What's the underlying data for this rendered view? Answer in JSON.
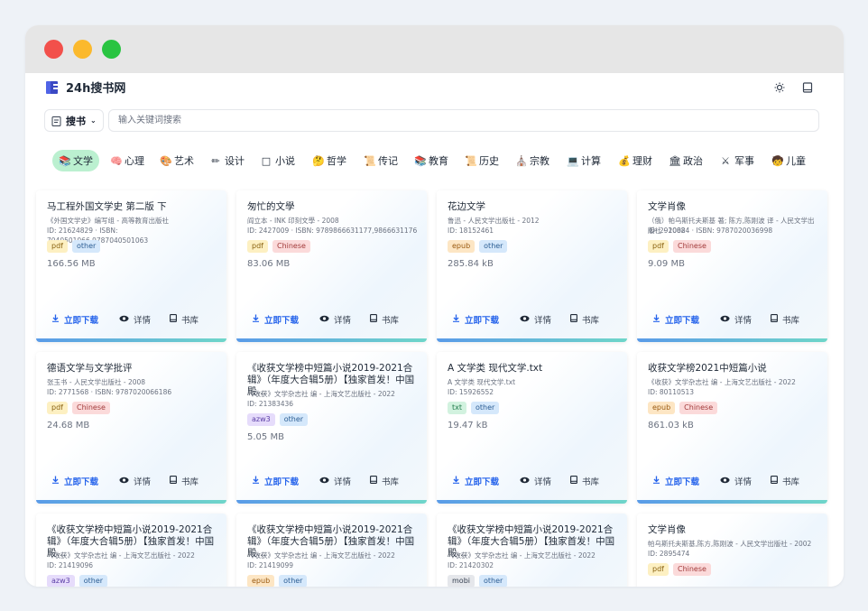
{
  "app": {
    "title": "24h搜书网",
    "search_type_label": "搜书",
    "search_placeholder": "输入关键词搜索",
    "search_value": "",
    "icons": {
      "logo": "book-logo-icon",
      "theme": "sun-icon",
      "library": "book-icon",
      "search_type": "clipboard-icon",
      "dropdown": "chevron-down-icon"
    }
  },
  "categories": [
    {
      "label": "文学",
      "icon": "📚",
      "active": true
    },
    {
      "label": "心理",
      "icon": "🧠"
    },
    {
      "label": "艺术",
      "icon": "🎨"
    },
    {
      "label": "设计",
      "icon": "✏"
    },
    {
      "label": "小说",
      "icon": "□"
    },
    {
      "label": "哲学",
      "icon": "🤔"
    },
    {
      "label": "传记",
      "icon": "📜"
    },
    {
      "label": "教育",
      "icon": "📚"
    },
    {
      "label": "历史",
      "icon": "📜"
    },
    {
      "label": "宗教",
      "icon": "⛪"
    },
    {
      "label": "计算",
      "icon": "💻"
    },
    {
      "label": "理财",
      "icon": "💰"
    },
    {
      "label": "政治",
      "icon": "🏛"
    },
    {
      "label": "军事",
      "icon": "⚔"
    },
    {
      "label": "儿童",
      "icon": "🧒"
    }
  ],
  "actions": {
    "download": "立即下载",
    "detail": "详情",
    "library": "书库"
  },
  "books": [
    {
      "title": "马工程外国文学史 第二版 下",
      "meta1": "《外国文学史》编写组 - 高等教育出版社",
      "meta2": "ID: 21624829 · ISBN: 7040501066,9787040501063",
      "format": "pdf",
      "tag2": "other",
      "size": "166.56 MB"
    },
    {
      "title": "匆忙的文學",
      "meta1": "阎立本 - INK 印刻文學 - 2008",
      "meta2": "ID: 2427009 · ISBN: 9789866631177,9866631176",
      "format": "pdf",
      "tag2": "Chinese",
      "size": "83.06 MB"
    },
    {
      "title": "花边文学",
      "meta1": "鲁迅 - 人民文学出版社 - 2012",
      "meta2": "ID: 18152461",
      "format": "epub",
      "tag2": "other",
      "size": "285.84 kB"
    },
    {
      "title": "文学肖像",
      "meta1": "（俄）帕乌斯托夫斯基 著; 陈方,陈刚波 译 - 人民文学出版社 - 2002",
      "meta2": "ID: 2910884 · ISBN: 9787020036998",
      "format": "pdf",
      "tag2": "Chinese",
      "size": "9.09 MB"
    },
    {
      "title": "德语文学与文学批评",
      "meta1": "张玉书 - 人民文学出版社 - 2008",
      "meta2": "ID: 2771568 · ISBN: 9787020066186",
      "format": "pdf",
      "tag2": "Chinese",
      "size": "24.68 MB"
    },
    {
      "title": "《收获文学榜中短篇小说2019-2021合辑》（年度大合辑5册）【独家首发！中国殿…",
      "meta1": "《收获》文学杂志社 编 - 上海文艺出版社 - 2022",
      "meta2": "ID: 21383436",
      "format": "azw3",
      "tag2": "other",
      "size": "5.05 MB"
    },
    {
      "title": "A 文学类 现代文学.txt",
      "meta1": "A 文学类 现代文学.txt",
      "meta2": "ID: 15926552",
      "format": "txt",
      "tag2": "other",
      "size": "19.47 kB"
    },
    {
      "title": "收获文学榜2021中短篇小说",
      "meta1": "《收获》文学杂志社 编 - 上海文艺出版社 - 2022",
      "meta2": "ID: 80110513",
      "format": "epub",
      "tag2": "Chinese",
      "size": "861.03 kB"
    },
    {
      "title": "《收获文学榜中短篇小说2019-2021合辑》（年度大合辑5册）【独家首发！中国殿…",
      "meta1": "《收获》文学杂志社 编 - 上海文艺出版社 - 2022",
      "meta2": "ID: 21419096",
      "format": "azw3",
      "tag2": "other",
      "size": ""
    },
    {
      "title": "《收获文学榜中短篇小说2019-2021合辑》（年度大合辑5册）【独家首发！中国殿…",
      "meta1": "《收获》文学杂志社 编 - 上海文艺出版社 - 2022",
      "meta2": "ID: 21419099",
      "format": "epub",
      "tag2": "other",
      "size": ""
    },
    {
      "title": "《收获文学榜中短篇小说2019-2021合辑》（年度大合辑5册）【独家首发！中国殿…",
      "meta1": "《收获》文学杂志社 编 - 上海文艺出版社 - 2022",
      "meta2": "ID: 21420302",
      "format": "mobi",
      "tag2": "other",
      "size": ""
    },
    {
      "title": "文学肖像",
      "meta1": "帕乌斯托夫斯基,陈方,陈刚波 - 人民文学出版社 - 2002",
      "meta2": "ID: 2895474",
      "format": "pdf",
      "tag2": "Chinese",
      "size": ""
    }
  ]
}
